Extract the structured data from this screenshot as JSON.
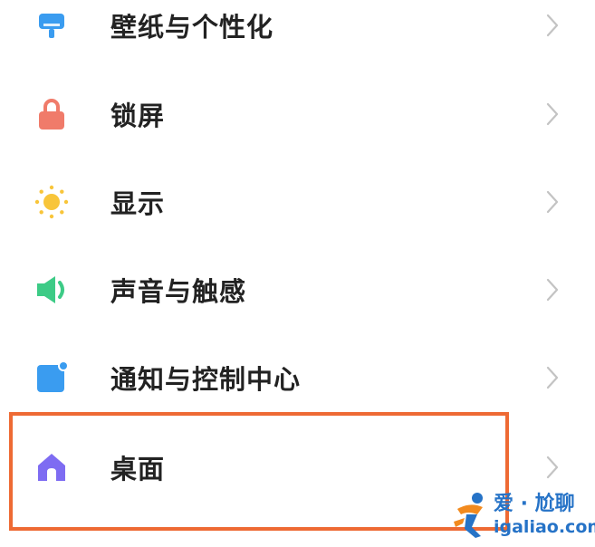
{
  "settings": {
    "items": [
      {
        "label": "壁纸与个性化",
        "icon": "wallpaper-icon",
        "icon_color": "#3A9CF0"
      },
      {
        "label": "锁屏",
        "icon": "lock-icon",
        "icon_color": "#F07B6A"
      },
      {
        "label": "显示",
        "icon": "sun-icon",
        "icon_color": "#F8C53A"
      },
      {
        "label": "声音与触感",
        "icon": "speaker-icon",
        "icon_color": "#3DCB86"
      },
      {
        "label": "通知与控制中心",
        "icon": "notification-icon",
        "icon_color": "#3A9CF0"
      },
      {
        "label": "桌面",
        "icon": "home-icon",
        "icon_color": "#7E6CF2"
      }
    ],
    "highlighted_item": "桌面",
    "highlight_color": "#EE6A34"
  },
  "watermark": {
    "line1": "爱 · 尬聊",
    "line2": "igaliao.com",
    "color": "#2673C7",
    "accent": "#F28A1E"
  }
}
